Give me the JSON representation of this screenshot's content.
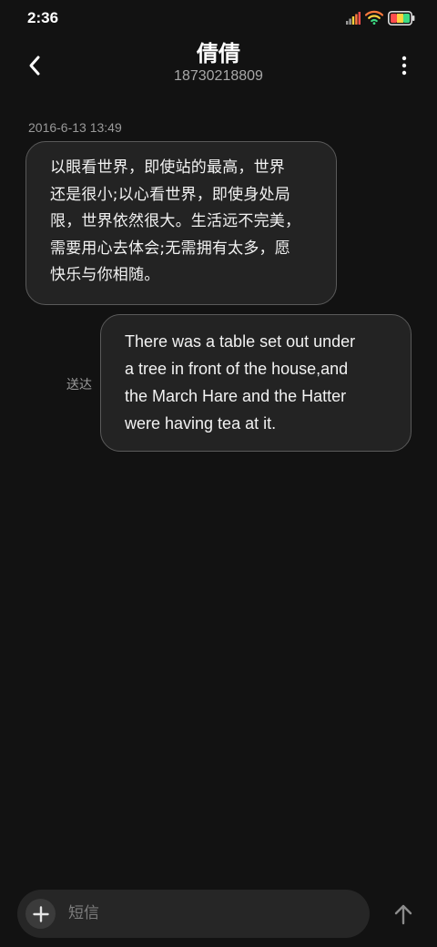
{
  "status_bar": {
    "time": "2:36",
    "battery_colors": [
      "#ff4d4d",
      "#ffd23f",
      "#3ddc84"
    ]
  },
  "header": {
    "contact_name": "倩倩",
    "contact_number": "18730218809",
    "back_icon": "chevron-left-icon",
    "more_icon": "more-vertical-icon"
  },
  "messages": {
    "timestamp": "2016-6-13 13:49",
    "received": [
      {
        "lines": [
          "以眼看世界，即使站的最高，世界",
          "还是很小;以心看世界，即使身处局",
          "限，世界依然很大。生活远不完美，",
          "需要用心去体会;无需拥有太多，愿",
          "快乐与你相随。"
        ]
      }
    ],
    "sent": [
      {
        "lines": [
          "There was a table set out under",
          "a tree in front of the house,and",
          "the March Hare and the Hatter",
          "were having tea at it."
        ],
        "status": "送达"
      }
    ]
  },
  "composer": {
    "placeholder": "短信",
    "value": "",
    "add_icon": "plus-icon",
    "send_icon": "arrow-up-icon"
  }
}
